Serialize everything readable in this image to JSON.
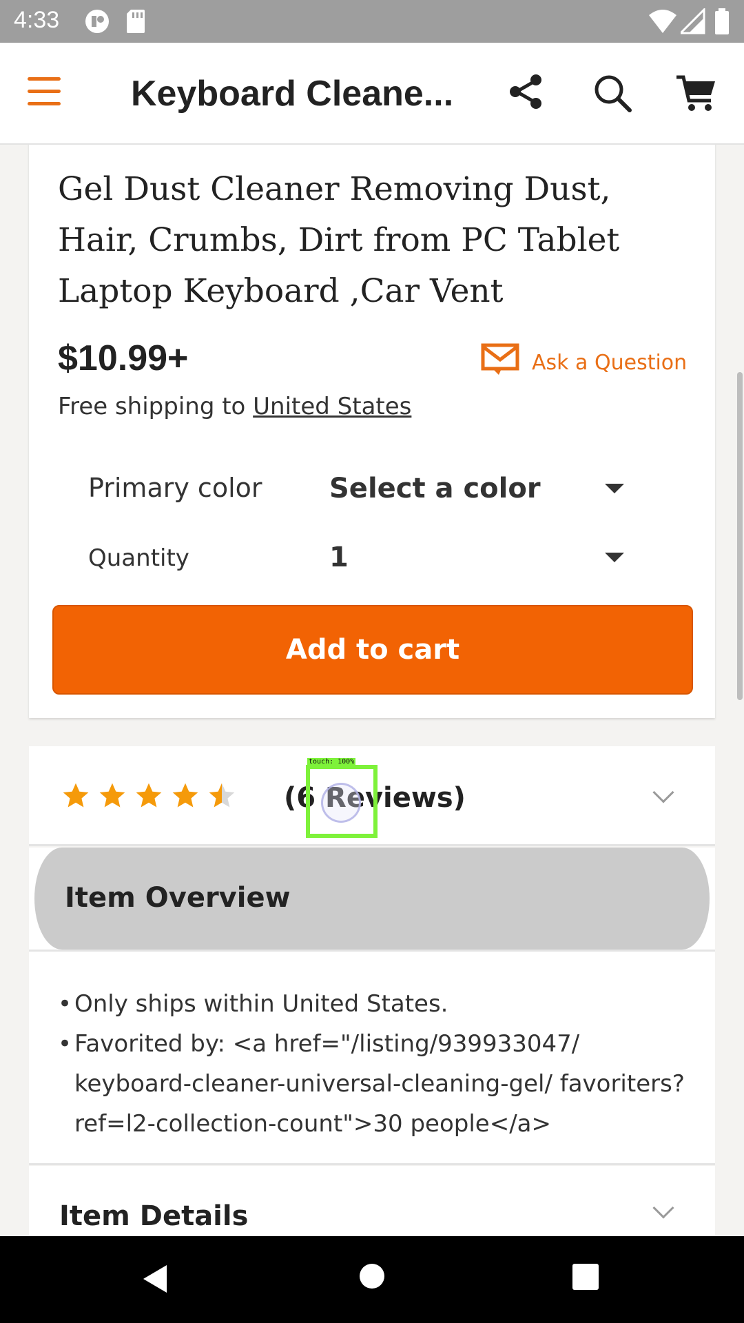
{
  "status_bar": {
    "time": "4:33"
  },
  "app_bar": {
    "title": "Keyboard Cleane..."
  },
  "product": {
    "title": "Gel Dust Cleaner Removing Dust, Hair, Crumbs, Dirt from PC Tablet Laptop Keyboard ,Car Vent",
    "price": "$10.99+",
    "ask_question": "Ask a Question",
    "shipping_prefix": "Free shipping to ",
    "shipping_country": "United States"
  },
  "options": [
    {
      "label": "Primary color",
      "value": "Select a color"
    },
    {
      "label": "Quantity",
      "value": "1"
    }
  ],
  "add_to_cart": "Add to cart",
  "reviews": {
    "rating": 4.5,
    "text": "(6 Reviews)"
  },
  "touch_indicator": {
    "label": "touch: 100%"
  },
  "overview": {
    "title": "Item Overview",
    "bullets": [
      "Only ships within United States.",
      "Favorited by: <a href=\"/listing/939933047/ keyboard-cleaner-universal-cleaning-gel/ favoriters?ref=l2-collection-count\">30 people</a>"
    ]
  },
  "details": {
    "title": "Item Details"
  },
  "colors": {
    "accent": "#f26304",
    "icon_orange": "#e96f16",
    "star": "#f59a0a"
  }
}
